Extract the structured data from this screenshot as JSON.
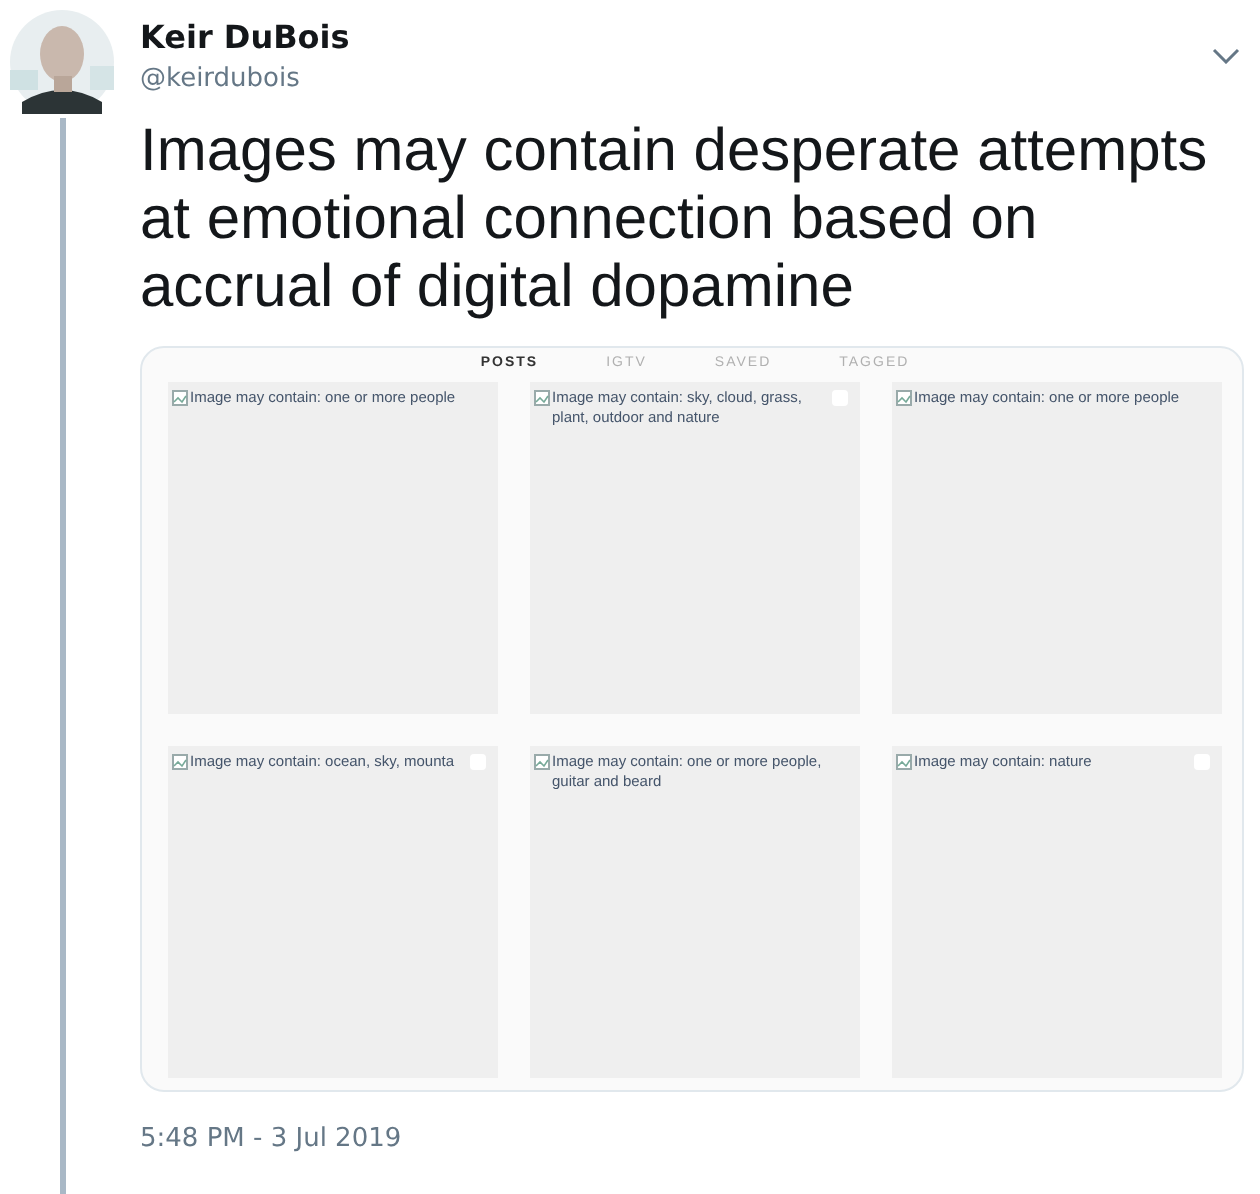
{
  "author": {
    "name": "Keir DuBois",
    "handle": "@keirdubois"
  },
  "tweet_text": "Images may contain desperate attempts at emotional connection based on accrual of digital dopamine",
  "card": {
    "tabs": [
      {
        "label": "POSTS",
        "selected": true
      },
      {
        "label": "IGTV",
        "selected": false
      },
      {
        "label": "SAVED",
        "selected": false
      },
      {
        "label": "TAGGED",
        "selected": false
      }
    ],
    "cells": [
      {
        "alt": "Image may contain: one or more people",
        "corner_icon": false
      },
      {
        "alt": "Image may contain: sky, cloud, grass, plant, outdoor and nature",
        "corner_icon": true
      },
      {
        "alt": "Image may contain: one or more people",
        "corner_icon": false
      },
      {
        "alt": "Image may contain: ocean, sky, mounta",
        "corner_icon": true
      },
      {
        "alt": "Image may contain: one or more people, guitar and beard",
        "corner_icon": false
      },
      {
        "alt": "Image may contain: nature",
        "corner_icon": true
      }
    ]
  },
  "timestamp": "5:48 PM - 3 Jul 2019"
}
